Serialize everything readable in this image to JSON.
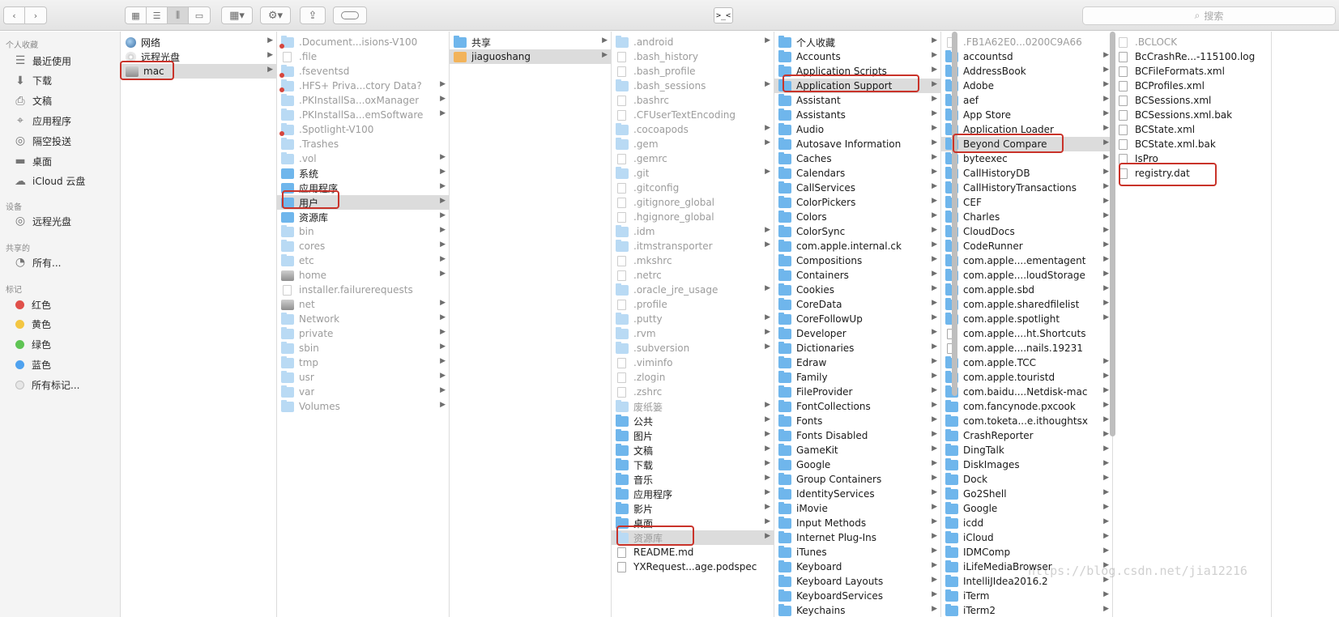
{
  "toolbar": {
    "back_icon": "chevron-left-icon",
    "forward_icon": "chevron-right-icon",
    "terminal_label": ">_<",
    "search_placeholder": "搜索"
  },
  "sidebar": {
    "sections": [
      {
        "title": "个人收藏",
        "items": [
          {
            "label": "最近使用",
            "icon": "recents-icon"
          },
          {
            "label": "下载",
            "icon": "downloads-icon"
          },
          {
            "label": "文稿",
            "icon": "documents-icon"
          },
          {
            "label": "应用程序",
            "icon": "applications-icon"
          },
          {
            "label": "隔空投送",
            "icon": "airdrop-icon"
          },
          {
            "label": "桌面",
            "icon": "desktop-icon"
          },
          {
            "label": "iCloud 云盘",
            "icon": "cloud-icon"
          }
        ]
      },
      {
        "title": "设备",
        "items": [
          {
            "label": "远程光盘",
            "icon": "disc-icon"
          }
        ]
      },
      {
        "title": "共享的",
        "items": [
          {
            "label": "所有...",
            "icon": "network-icon"
          }
        ]
      },
      {
        "title": "标记",
        "items": [
          {
            "label": "红色",
            "color": "#e0504a"
          },
          {
            "label": "黄色",
            "color": "#f3c642"
          },
          {
            "label": "绿色",
            "color": "#5fc454"
          },
          {
            "label": "蓝色",
            "color": "#4fa2ef"
          },
          {
            "label": "所有标记...",
            "color": "#e6e6e6"
          }
        ]
      }
    ]
  },
  "columns": [
    {
      "items": [
        {
          "label": "网络",
          "icon": "globe",
          "chev": true
        },
        {
          "label": "远程光盘",
          "icon": "cd",
          "chev": true
        },
        {
          "label": "mac",
          "icon": "disk",
          "chev": true,
          "selected": true
        }
      ]
    },
    {
      "items": [
        {
          "label": ".Document...isions-V100",
          "icon": "folder",
          "dim": true,
          "badge": true
        },
        {
          "label": ".file",
          "icon": "file",
          "dim": true
        },
        {
          "label": ".fseventsd",
          "icon": "folder",
          "dim": true,
          "badge": true
        },
        {
          "label": ".HFS+ Priva...ctory Data?",
          "icon": "folder",
          "dim": true,
          "badge": true,
          "chev": true
        },
        {
          "label": ".PKInstallSa...oxManager",
          "icon": "folder",
          "dim": true,
          "chev": true
        },
        {
          "label": ".PKInstallSa...emSoftware",
          "icon": "folder",
          "dim": true,
          "chev": true
        },
        {
          "label": ".Spotlight-V100",
          "icon": "folder",
          "dim": true,
          "badge": true
        },
        {
          "label": ".Trashes",
          "icon": "folder",
          "dim": true
        },
        {
          "label": ".vol",
          "icon": "folder",
          "dim": true,
          "chev": true
        },
        {
          "label": "系统",
          "icon": "sys",
          "chev": true
        },
        {
          "label": "应用程序",
          "icon": "sys",
          "chev": true
        },
        {
          "label": "用户",
          "icon": "sys",
          "chev": true,
          "selected": true
        },
        {
          "label": "资源库",
          "icon": "sys",
          "chev": true
        },
        {
          "label": "bin",
          "icon": "folder",
          "dim": true,
          "chev": true
        },
        {
          "label": "cores",
          "icon": "folder",
          "dim": true,
          "chev": true
        },
        {
          "label": "etc",
          "icon": "folder",
          "dim": true,
          "chev": true
        },
        {
          "label": "home",
          "icon": "disk",
          "dim": true,
          "chev": true
        },
        {
          "label": "installer.failurerequests",
          "icon": "file",
          "dim": true
        },
        {
          "label": "net",
          "icon": "disk",
          "dim": true,
          "chev": true
        },
        {
          "label": "Network",
          "icon": "folder",
          "dim": true,
          "chev": true
        },
        {
          "label": "private",
          "icon": "folder",
          "dim": true,
          "chev": true
        },
        {
          "label": "sbin",
          "icon": "folder",
          "dim": true,
          "chev": true
        },
        {
          "label": "tmp",
          "icon": "folder",
          "dim": true,
          "chev": true
        },
        {
          "label": "usr",
          "icon": "folder",
          "dim": true,
          "chev": true
        },
        {
          "label": "var",
          "icon": "folder",
          "dim": true,
          "chev": true
        },
        {
          "label": "Volumes",
          "icon": "folder",
          "dim": true,
          "chev": true
        }
      ]
    },
    {
      "items": [
        {
          "label": "共享",
          "icon": "folder",
          "chev": true
        },
        {
          "label": "jiaguoshang",
          "icon": "home",
          "chev": true,
          "selected": true
        }
      ]
    },
    {
      "items": [
        {
          "label": ".android",
          "icon": "folder",
          "dim": true,
          "chev": true
        },
        {
          "label": ".bash_history",
          "icon": "file",
          "dim": true
        },
        {
          "label": ".bash_profile",
          "icon": "file",
          "dim": true
        },
        {
          "label": ".bash_sessions",
          "icon": "folder",
          "dim": true,
          "chev": true
        },
        {
          "label": ".bashrc",
          "icon": "file",
          "dim": true
        },
        {
          "label": ".CFUserTextEncoding",
          "icon": "file",
          "dim": true
        },
        {
          "label": ".cocoapods",
          "icon": "folder",
          "dim": true,
          "chev": true
        },
        {
          "label": ".gem",
          "icon": "folder",
          "dim": true,
          "chev": true
        },
        {
          "label": ".gemrc",
          "icon": "file",
          "dim": true
        },
        {
          "label": ".git",
          "icon": "folder",
          "dim": true,
          "chev": true
        },
        {
          "label": ".gitconfig",
          "icon": "file",
          "dim": true
        },
        {
          "label": ".gitignore_global",
          "icon": "file",
          "dim": true
        },
        {
          "label": ".hgignore_global",
          "icon": "file",
          "dim": true
        },
        {
          "label": ".idm",
          "icon": "folder",
          "dim": true,
          "chev": true
        },
        {
          "label": ".itmstransporter",
          "icon": "folder",
          "dim": true,
          "chev": true
        },
        {
          "label": ".mkshrc",
          "icon": "file",
          "dim": true
        },
        {
          "label": ".netrc",
          "icon": "file",
          "dim": true
        },
        {
          "label": ".oracle_jre_usage",
          "icon": "folder",
          "dim": true,
          "chev": true
        },
        {
          "label": ".profile",
          "icon": "file",
          "dim": true
        },
        {
          "label": ".putty",
          "icon": "folder",
          "dim": true,
          "chev": true
        },
        {
          "label": ".rvm",
          "icon": "folder",
          "dim": true,
          "chev": true
        },
        {
          "label": ".subversion",
          "icon": "folder",
          "dim": true,
          "chev": true
        },
        {
          "label": ".viminfo",
          "icon": "file",
          "dim": true
        },
        {
          "label": ".zlogin",
          "icon": "file",
          "dim": true
        },
        {
          "label": ".zshrc",
          "icon": "file",
          "dim": true
        },
        {
          "label": "废纸篓",
          "icon": "folder",
          "dim": true,
          "chev": true
        },
        {
          "label": "公共",
          "icon": "folder",
          "chev": true
        },
        {
          "label": "图片",
          "icon": "folder",
          "chev": true
        },
        {
          "label": "文稿",
          "icon": "folder",
          "chev": true
        },
        {
          "label": "下载",
          "icon": "folder",
          "chev": true
        },
        {
          "label": "音乐",
          "icon": "folder",
          "chev": true
        },
        {
          "label": "应用程序",
          "icon": "folder",
          "chev": true
        },
        {
          "label": "影片",
          "icon": "folder",
          "chev": true
        },
        {
          "label": "桌面",
          "icon": "folder",
          "chev": true
        },
        {
          "label": "资源库",
          "icon": "folder",
          "dim": true,
          "chev": true,
          "selected": true
        },
        {
          "label": "README.md",
          "icon": "file"
        },
        {
          "label": "YXRequest...age.podspec",
          "icon": "file"
        }
      ]
    },
    {
      "items": [
        {
          "label": "个人收藏",
          "icon": "folder",
          "chev": true
        },
        {
          "label": "Accounts",
          "icon": "folder",
          "chev": true
        },
        {
          "label": "Application Scripts",
          "icon": "folder",
          "chev": true
        },
        {
          "label": "Application Support",
          "icon": "folder",
          "chev": true,
          "selected": true
        },
        {
          "label": "Assistant",
          "icon": "folder",
          "chev": true
        },
        {
          "label": "Assistants",
          "icon": "folder",
          "chev": true
        },
        {
          "label": "Audio",
          "icon": "folder",
          "chev": true
        },
        {
          "label": "Autosave Information",
          "icon": "folder",
          "chev": true
        },
        {
          "label": "Caches",
          "icon": "folder",
          "chev": true
        },
        {
          "label": "Calendars",
          "icon": "folder",
          "chev": true
        },
        {
          "label": "CallServices",
          "icon": "folder",
          "chev": true
        },
        {
          "label": "ColorPickers",
          "icon": "folder",
          "chev": true
        },
        {
          "label": "Colors",
          "icon": "folder",
          "chev": true
        },
        {
          "label": "ColorSync",
          "icon": "folder",
          "chev": true
        },
        {
          "label": "com.apple.internal.ck",
          "icon": "folder",
          "chev": true
        },
        {
          "label": "Compositions",
          "icon": "folder",
          "chev": true
        },
        {
          "label": "Containers",
          "icon": "folder",
          "chev": true
        },
        {
          "label": "Cookies",
          "icon": "folder",
          "chev": true
        },
        {
          "label": "CoreData",
          "icon": "folder",
          "chev": true
        },
        {
          "label": "CoreFollowUp",
          "icon": "folder",
          "chev": true
        },
        {
          "label": "Developer",
          "icon": "folder",
          "chev": true
        },
        {
          "label": "Dictionaries",
          "icon": "folder",
          "chev": true
        },
        {
          "label": "Edraw",
          "icon": "folder",
          "chev": true
        },
        {
          "label": "Family",
          "icon": "folder",
          "chev": true
        },
        {
          "label": "FileProvider",
          "icon": "folder",
          "chev": true
        },
        {
          "label": "FontCollections",
          "icon": "folder",
          "chev": true
        },
        {
          "label": "Fonts",
          "icon": "folder",
          "chev": true
        },
        {
          "label": "Fonts Disabled",
          "icon": "folder",
          "chev": true
        },
        {
          "label": "GameKit",
          "icon": "folder",
          "chev": true
        },
        {
          "label": "Google",
          "icon": "folder",
          "chev": true
        },
        {
          "label": "Group Containers",
          "icon": "folder",
          "chev": true
        },
        {
          "label": "IdentityServices",
          "icon": "folder",
          "chev": true
        },
        {
          "label": "iMovie",
          "icon": "folder",
          "chev": true
        },
        {
          "label": "Input Methods",
          "icon": "folder",
          "chev": true
        },
        {
          "label": "Internet Plug-Ins",
          "icon": "folder",
          "chev": true
        },
        {
          "label": "iTunes",
          "icon": "folder",
          "chev": true
        },
        {
          "label": "Keyboard",
          "icon": "folder",
          "chev": true
        },
        {
          "label": "Keyboard Layouts",
          "icon": "folder",
          "chev": true
        },
        {
          "label": "KeyboardServices",
          "icon": "folder",
          "chev": true
        },
        {
          "label": "Keychains",
          "icon": "folder",
          "chev": true
        }
      ]
    },
    {
      "items": [
        {
          "label": ".FB1A62E0...0200C9A66",
          "icon": "file",
          "dim": true
        },
        {
          "label": "accountsd",
          "icon": "folder",
          "chev": true
        },
        {
          "label": "AddressBook",
          "icon": "folder",
          "chev": true
        },
        {
          "label": "Adobe",
          "icon": "folder",
          "chev": true
        },
        {
          "label": "aef",
          "icon": "folder",
          "chev": true
        },
        {
          "label": "App Store",
          "icon": "folder",
          "chev": true
        },
        {
          "label": "Application Loader",
          "icon": "folder",
          "chev": true
        },
        {
          "label": "Beyond Compare",
          "icon": "folder",
          "chev": true,
          "selected": true
        },
        {
          "label": "byteexec",
          "icon": "folder",
          "chev": true
        },
        {
          "label": "CallHistoryDB",
          "icon": "folder",
          "chev": true
        },
        {
          "label": "CallHistoryTransactions",
          "icon": "folder",
          "chev": true
        },
        {
          "label": "CEF",
          "icon": "folder",
          "chev": true
        },
        {
          "label": "Charles",
          "icon": "folder",
          "chev": true
        },
        {
          "label": "CloudDocs",
          "icon": "folder",
          "chev": true
        },
        {
          "label": "CodeRunner",
          "icon": "folder",
          "chev": true
        },
        {
          "label": "com.apple....ementagent",
          "icon": "folder",
          "chev": true
        },
        {
          "label": "com.apple....loudStorage",
          "icon": "folder",
          "chev": true
        },
        {
          "label": "com.apple.sbd",
          "icon": "folder",
          "chev": true
        },
        {
          "label": "com.apple.sharedfilelist",
          "icon": "folder",
          "chev": true
        },
        {
          "label": "com.apple.spotlight",
          "icon": "folder",
          "chev": true
        },
        {
          "label": "com.apple....ht.Shortcuts",
          "icon": "file"
        },
        {
          "label": "com.apple....nails.19231",
          "icon": "file"
        },
        {
          "label": "com.apple.TCC",
          "icon": "folder",
          "chev": true
        },
        {
          "label": "com.apple.touristd",
          "icon": "folder",
          "chev": true
        },
        {
          "label": "com.baidu....Netdisk-mac",
          "icon": "folder",
          "chev": true
        },
        {
          "label": "com.fancynode.pxcook",
          "icon": "folder",
          "chev": true
        },
        {
          "label": "com.toketa...e.ithoughtsx",
          "icon": "folder",
          "chev": true
        },
        {
          "label": "CrashReporter",
          "icon": "folder",
          "chev": true
        },
        {
          "label": "DingTalk",
          "icon": "folder",
          "chev": true
        },
        {
          "label": "DiskImages",
          "icon": "folder",
          "chev": true
        },
        {
          "label": "Dock",
          "icon": "folder",
          "chev": true
        },
        {
          "label": "Go2Shell",
          "icon": "folder",
          "chev": true
        },
        {
          "label": "Google",
          "icon": "folder",
          "chev": true
        },
        {
          "label": "icdd",
          "icon": "folder",
          "chev": true
        },
        {
          "label": "iCloud",
          "icon": "folder",
          "chev": true
        },
        {
          "label": "IDMComp",
          "icon": "folder",
          "chev": true
        },
        {
          "label": "iLifeMediaBrowser",
          "icon": "folder",
          "chev": true
        },
        {
          "label": "IntelliJIdea2016.2",
          "icon": "folder",
          "chev": true
        },
        {
          "label": "iTerm",
          "icon": "folder",
          "chev": true
        },
        {
          "label": "iTerm2",
          "icon": "folder",
          "chev": true
        }
      ]
    },
    {
      "items": [
        {
          "label": ".BCLOCK",
          "icon": "file",
          "dim": true
        },
        {
          "label": "BcCrashRe...-115100.log",
          "icon": "file"
        },
        {
          "label": "BCFileFormats.xml",
          "icon": "file"
        },
        {
          "label": "BCProfiles.xml",
          "icon": "file"
        },
        {
          "label": "BCSessions.xml",
          "icon": "file"
        },
        {
          "label": "BCSessions.xml.bak",
          "icon": "file"
        },
        {
          "label": "BCState.xml",
          "icon": "file"
        },
        {
          "label": "BCState.xml.bak",
          "icon": "file"
        },
        {
          "label": "IsPro",
          "icon": "file"
        },
        {
          "label": "registry.dat",
          "icon": "file"
        }
      ]
    }
  ],
  "watermark": "https://blog.csdn.net/jia12216"
}
